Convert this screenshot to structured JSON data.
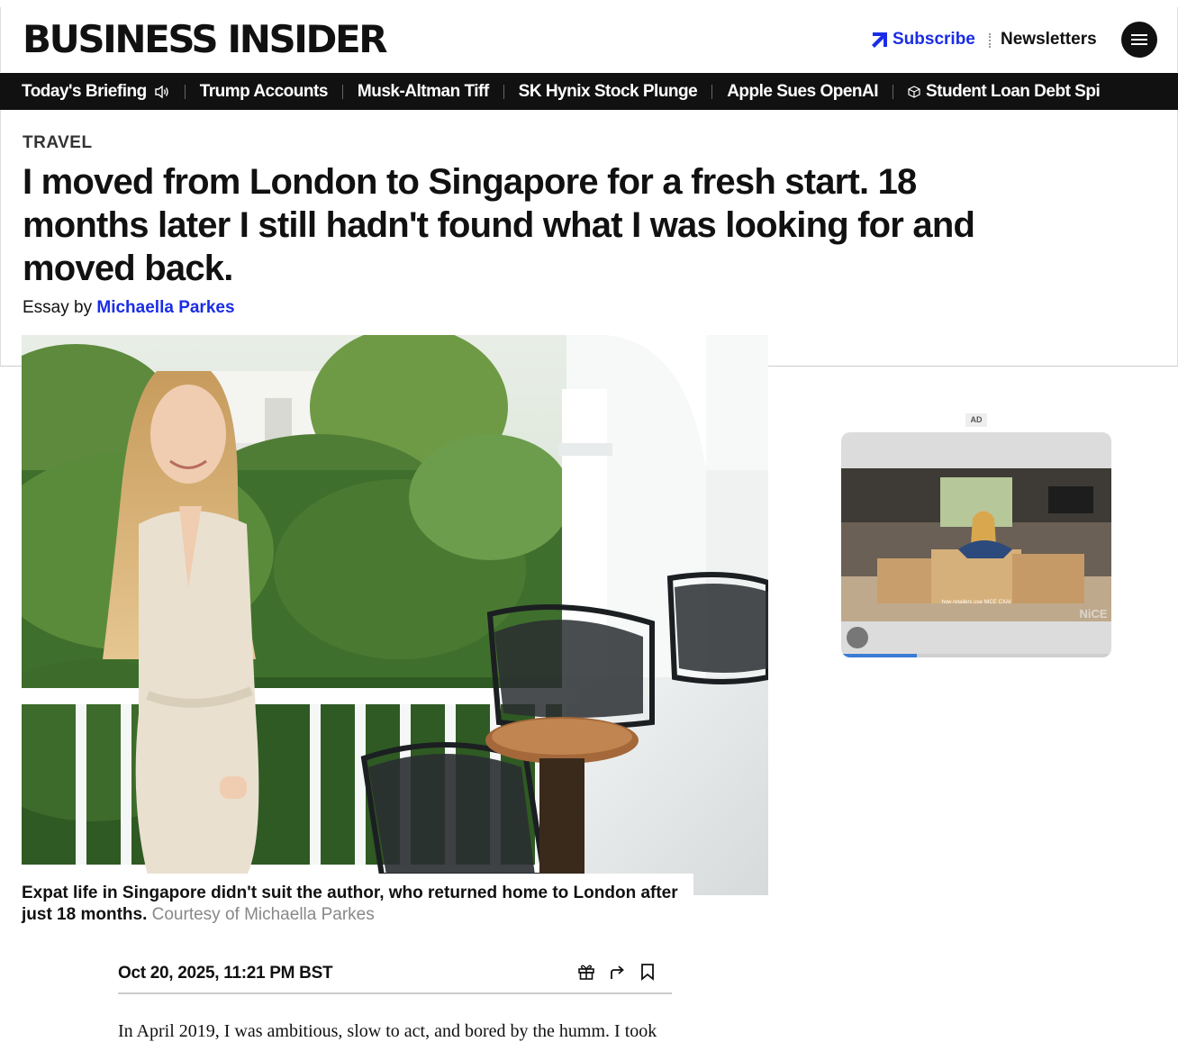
{
  "header": {
    "logo": "BUSINESS INSIDER",
    "subscribe_label": "Subscribe",
    "newsletters_label": "Newsletters"
  },
  "nav": {
    "items": [
      "Today's Briefing",
      "Trump Accounts",
      "Musk-Altman Tiff",
      "SK Hynix Stock Plunge",
      "Apple Sues OpenAI",
      "Student Loan Debt Spi"
    ]
  },
  "article": {
    "category": "TRAVEL",
    "headline": "I moved from London to Singapore for a fresh start. 18 months later I still hadn't found what I was looking for and moved back.",
    "byline_prefix": "Essay by",
    "author": "Michaella Parkes",
    "caption": "Expat life in Singapore didn't suit the author, who returned home to London after just 18 months.",
    "credit": "Courtesy of Michaella Parkes",
    "date": "Oct 20, 2025, 11:21 PM BST",
    "body_start": "In April 2019, I was ambitious, slow to act, and bored by the humm. I took"
  },
  "ad": {
    "label": "AD",
    "video_caption": "how retailers use NICE CXAI",
    "brand": "NiCE",
    "progress": 0.28
  },
  "colors": {
    "brand_blue": "#1a2de6",
    "nav_bg": "#111111"
  }
}
